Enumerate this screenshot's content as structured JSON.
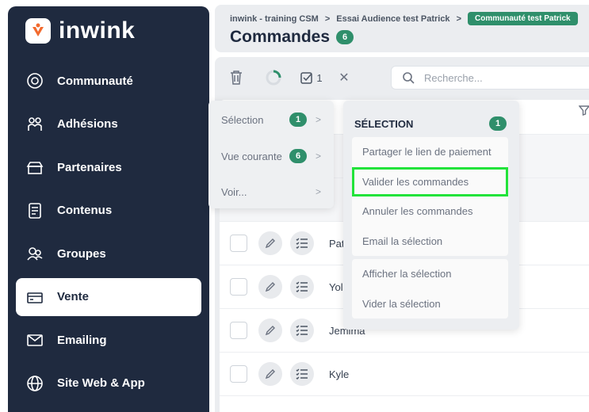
{
  "sidebar": {
    "logo_text": "inwink",
    "items": [
      {
        "label": "Communauté",
        "icon": "community-icon"
      },
      {
        "label": "Adhésions",
        "icon": "members-icon"
      },
      {
        "label": "Partenaires",
        "icon": "partners-icon"
      },
      {
        "label": "Contenus",
        "icon": "content-icon"
      },
      {
        "label": "Groupes",
        "icon": "groups-icon"
      },
      {
        "label": "Vente",
        "icon": "sales-icon",
        "active": true
      },
      {
        "label": "Emailing",
        "icon": "email-icon"
      },
      {
        "label": "Site Web & App",
        "icon": "globe-icon"
      }
    ]
  },
  "header": {
    "breadcrumb": [
      "inwink - training CSM",
      "Essai Audience test Patrick"
    ],
    "breadcrumb_badge": "Communauté test Patrick",
    "title": "Commandes",
    "count": "6"
  },
  "toolbar": {
    "selected_count": "1",
    "search_placeholder": "Recherche..."
  },
  "table": {
    "rows": [
      {
        "name": "Pat"
      },
      {
        "name": "Yol"
      },
      {
        "name": "Jemima"
      },
      {
        "name": "Kyle"
      }
    ]
  },
  "menu_left": {
    "items": [
      {
        "label": "Sélection",
        "badge": "1"
      },
      {
        "label": "Vue courante",
        "badge": "6"
      },
      {
        "label": "Voir...",
        "badge": null
      }
    ]
  },
  "menu_right": {
    "header": "SÉLECTION",
    "count": "1",
    "group1": [
      "Partager le lien de paiement",
      "Valider les commandes",
      "Annuler les commandes",
      "Email la sélection"
    ],
    "group2": [
      "Afficher la sélection",
      "Vider la sélection"
    ]
  },
  "colors": {
    "sidebar": "#1f2a3f",
    "accent": "#2f8f6b",
    "logo_orange": "#f26a2e",
    "highlight": "#22e33a"
  }
}
